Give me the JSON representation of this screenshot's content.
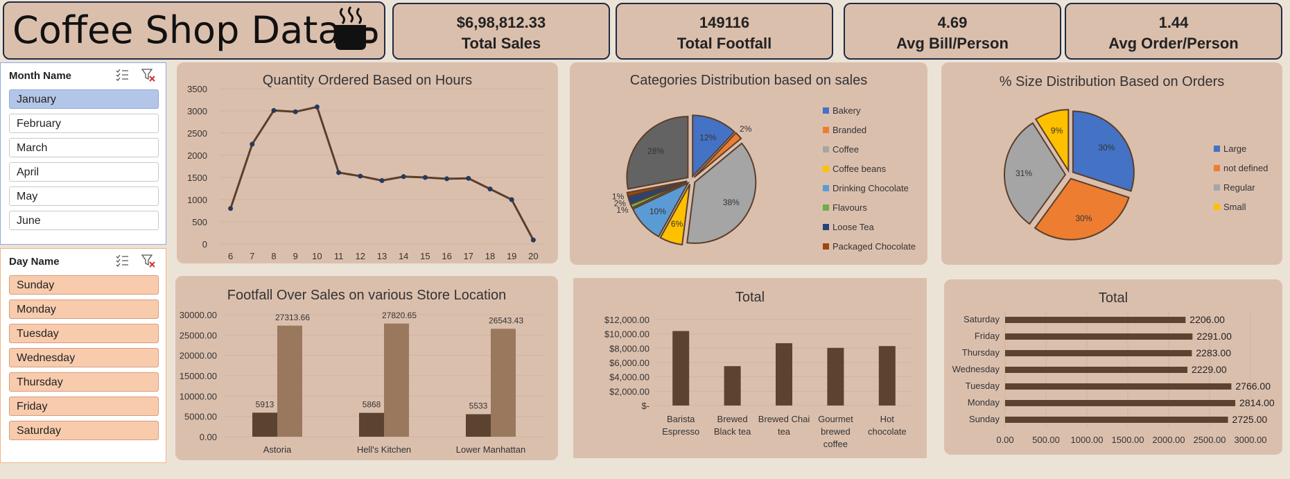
{
  "title": "Coffee Shop Data",
  "kpis": [
    {
      "value": "$6,98,812.33",
      "label": "Total Sales"
    },
    {
      "value": "149116",
      "label": "Total Footfall"
    },
    {
      "value": "4.69",
      "label": "Avg Bill/Person"
    },
    {
      "value": "1.44",
      "label": "Avg Order/Person"
    }
  ],
  "slicers": {
    "month": {
      "header": "Month Name",
      "items": [
        "January",
        "February",
        "March",
        "April",
        "May",
        "June"
      ],
      "selected": "January"
    },
    "day": {
      "header": "Day Name",
      "items": [
        "Sunday",
        "Monday",
        "Tuesday",
        "Wednesday",
        "Thursday",
        "Friday",
        "Saturday"
      ]
    }
  },
  "colors": {
    "bar_dark": "#5b4330",
    "bar_light": "#9a785d",
    "line": "#5a3e2b",
    "panel": "#dbbfad"
  },
  "chart_data": [
    {
      "type": "line",
      "title": "Quantity Ordered Based on Hours",
      "x": [
        6,
        7,
        8,
        9,
        10,
        11,
        12,
        13,
        14,
        15,
        16,
        17,
        18,
        19,
        20
      ],
      "values": [
        800,
        2250,
        3010,
        2980,
        3090,
        1610,
        1530,
        1430,
        1520,
        1500,
        1470,
        1480,
        1240,
        1000,
        90
      ],
      "ylim": [
        0,
        3500
      ],
      "yticks": [
        "0",
        "500",
        "1000",
        "1500",
        "2000",
        "2500",
        "3000",
        "3500"
      ]
    },
    {
      "type": "pie",
      "title": "Categories Distribution based on sales",
      "legend": [
        "Bakery",
        "Branded",
        "Coffee",
        "Coffee beans",
        "Drinking Chocolate",
        "Flavours",
        "Loose Tea",
        "Packaged Chocolate"
      ],
      "values": [
        12,
        2,
        38,
        6,
        10,
        1,
        2,
        1,
        28
      ],
      "labels": [
        "12%",
        "2%",
        "38%",
        "6%",
        "10%",
        "1%",
        "2%",
        "1%",
        "28%"
      ],
      "colors": [
        "#4472c4",
        "#ed7d31",
        "#a5a5a5",
        "#ffc000",
        "#5b9bd5",
        "#70ad47",
        "#264478",
        "#9e480e",
        "#636363"
      ]
    },
    {
      "type": "pie",
      "title": "% Size Distribution Based on Orders",
      "legend": [
        "Large",
        "not defined",
        "Regular",
        "Small"
      ],
      "values": [
        30,
        30,
        31,
        9
      ],
      "labels": [
        "30%",
        "30%",
        "31%",
        "9%"
      ],
      "colors": [
        "#4472c4",
        "#ed7d31",
        "#a5a5a5",
        "#ffc000"
      ]
    },
    {
      "type": "bar",
      "title": "Footfall Over Sales on various Store Location",
      "categories": [
        "Astoria",
        "Hell's Kitchen",
        "Lower Manhattan"
      ],
      "series": [
        {
          "values": [
            5913,
            5868,
            5533
          ],
          "labels": [
            "5913",
            "5868",
            "5533"
          ]
        },
        {
          "values": [
            27313.66,
            27820.65,
            26543.43
          ],
          "labels": [
            "27313.66",
            "27820.65",
            "26543.43"
          ]
        }
      ],
      "ylim": [
        0,
        30000
      ],
      "yticks": [
        "0.00",
        "5000.00",
        "10000.00",
        "15000.00",
        "20000.00",
        "25000.00",
        "30000.00"
      ]
    },
    {
      "type": "bar",
      "title": "Total",
      "categories": [
        [
          "Barista",
          "Espresso"
        ],
        [
          "Brewed",
          "Black tea"
        ],
        [
          "Brewed Chai",
          "tea"
        ],
        [
          "Gourmet",
          "brewed",
          "coffee"
        ],
        [
          "Hot",
          "chocolate"
        ]
      ],
      "values": [
        10400,
        5500,
        8700,
        8050,
        8300
      ],
      "ylim": [
        0,
        12000
      ],
      "yticks": [
        "$-",
        "$2,000.00",
        "$4,000.00",
        "$6,000.00",
        "$8,000.00",
        "$10,000.00",
        "$12,000.00"
      ]
    },
    {
      "type": "bar",
      "orientation": "horizontal",
      "title": "Total",
      "categories": [
        "Saturday",
        "Friday",
        "Thursday",
        "Wednesday",
        "Tuesday",
        "Monday",
        "Sunday"
      ],
      "values": [
        2206,
        2291,
        2283,
        2229,
        2766,
        2814,
        2725
      ],
      "labels": [
        "2206.00",
        "2291.00",
        "2283.00",
        "2229.00",
        "2766.00",
        "2814.00",
        "2725.00"
      ],
      "xlim": [
        0,
        3000
      ],
      "xticks": [
        "0.00",
        "500.00",
        "1000.00",
        "1500.00",
        "2000.00",
        "2500.00",
        "3000.00"
      ]
    }
  ]
}
